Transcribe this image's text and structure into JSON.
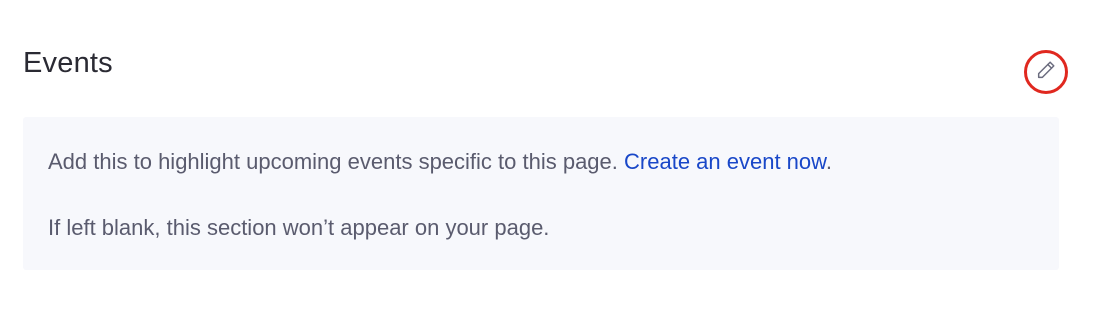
{
  "section": {
    "title": "Events",
    "edit_icon": "pencil-icon",
    "accent_color": "#e0281f"
  },
  "panel": {
    "line1_text": "Add this to highlight upcoming events specific to this page.",
    "line1_link": "Create an event now",
    "line1_suffix": ".",
    "line2_text": "If left blank, this section won’t appear on your page."
  }
}
